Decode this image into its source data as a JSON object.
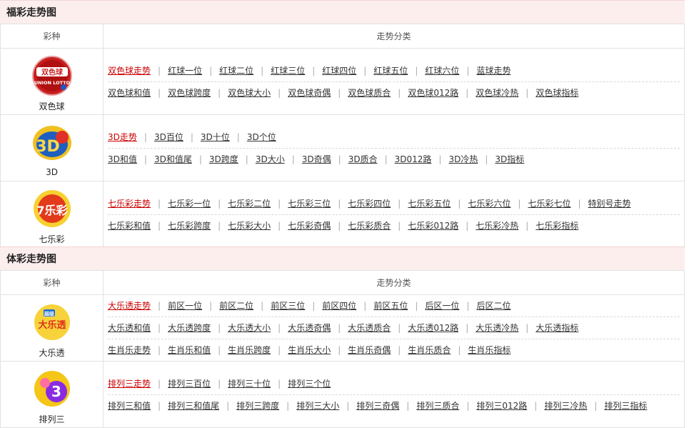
{
  "fucai": {
    "title": "福彩走势图",
    "header": {
      "col1": "彩种",
      "col2": "走势分类"
    },
    "lotteries": [
      {
        "name": "双色球",
        "logo": {
          "icon": "ssq-logo-icon",
          "text1": "双色球",
          "text2": "UNION LOTTO",
          "color": "#c81e1e"
        },
        "rows": [
          [
            "双色球走势",
            "红球一位",
            "红球二位",
            "红球三位",
            "红球四位",
            "红球五位",
            "红球六位",
            "蓝球走势"
          ],
          [
            "双色球和值",
            "双色球跨度",
            "双色球大小",
            "双色球奇偶",
            "双色球质合",
            "双色球012路",
            "双色球冷热",
            "双色球指标"
          ]
        ]
      },
      {
        "name": "3D",
        "logo": {
          "icon": "3d-logo-icon",
          "text1": "3D",
          "color": "#1e5fbf"
        },
        "rows": [
          [
            "3D走势",
            "3D百位",
            "3D十位",
            "3D个位"
          ],
          [
            "3D和值",
            "3D和值尾",
            "3D跨度",
            "3D大小",
            "3D奇偶",
            "3D质合",
            "3D012路",
            "3D冷热",
            "3D指标"
          ]
        ]
      },
      {
        "name": "七乐彩",
        "logo": {
          "icon": "qlc-logo-icon",
          "text1": "7乐彩",
          "color": "#e23a1a"
        },
        "rows": [
          [
            "七乐彩走势",
            "七乐彩一位",
            "七乐彩二位",
            "七乐彩三位",
            "七乐彩四位",
            "七乐彩五位",
            "七乐彩六位",
            "七乐彩七位",
            "特别号走势"
          ],
          [
            "七乐彩和值",
            "七乐彩跨度",
            "七乐彩大小",
            "七乐彩奇偶",
            "七乐彩质合",
            "七乐彩012路",
            "七乐彩冷热",
            "七乐彩指标"
          ]
        ]
      }
    ]
  },
  "ticai": {
    "title": "体彩走势图",
    "header": {
      "col1": "彩种",
      "col2": "走势分类"
    },
    "lotteries": [
      {
        "name": "大乐透",
        "logo": {
          "icon": "dlt-logo-icon",
          "text1": "超级",
          "text2": "大乐透",
          "color": "#e0301e"
        },
        "rows": [
          [
            "大乐透走势",
            "前区一位",
            "前区二位",
            "前区三位",
            "前区四位",
            "前区五位",
            "后区一位",
            "后区二位"
          ],
          [
            "大乐透和值",
            "大乐透跨度",
            "大乐透大小",
            "大乐透奇偶",
            "大乐透质合",
            "大乐透012路",
            "大乐透冷热",
            "大乐透指标"
          ],
          [
            "生肖乐走势",
            "生肖乐和值",
            "生肖乐跨度",
            "生肖乐大小",
            "生肖乐奇偶",
            "生肖乐质合",
            "生肖乐指标"
          ]
        ]
      },
      {
        "name": "排列三",
        "logo": {
          "icon": "pl3-logo-icon",
          "text1": "3",
          "color": "#8a2be2"
        },
        "rows": [
          [
            "排列三走势",
            "排列三百位",
            "排列三十位",
            "排列三个位"
          ],
          [
            "排列三和值",
            "排列三和值尾",
            "排列三跨度",
            "排列三大小",
            "排列三奇偶",
            "排列三质合",
            "排列三012路",
            "排列三冷热",
            "排列三指标"
          ]
        ]
      }
    ]
  }
}
